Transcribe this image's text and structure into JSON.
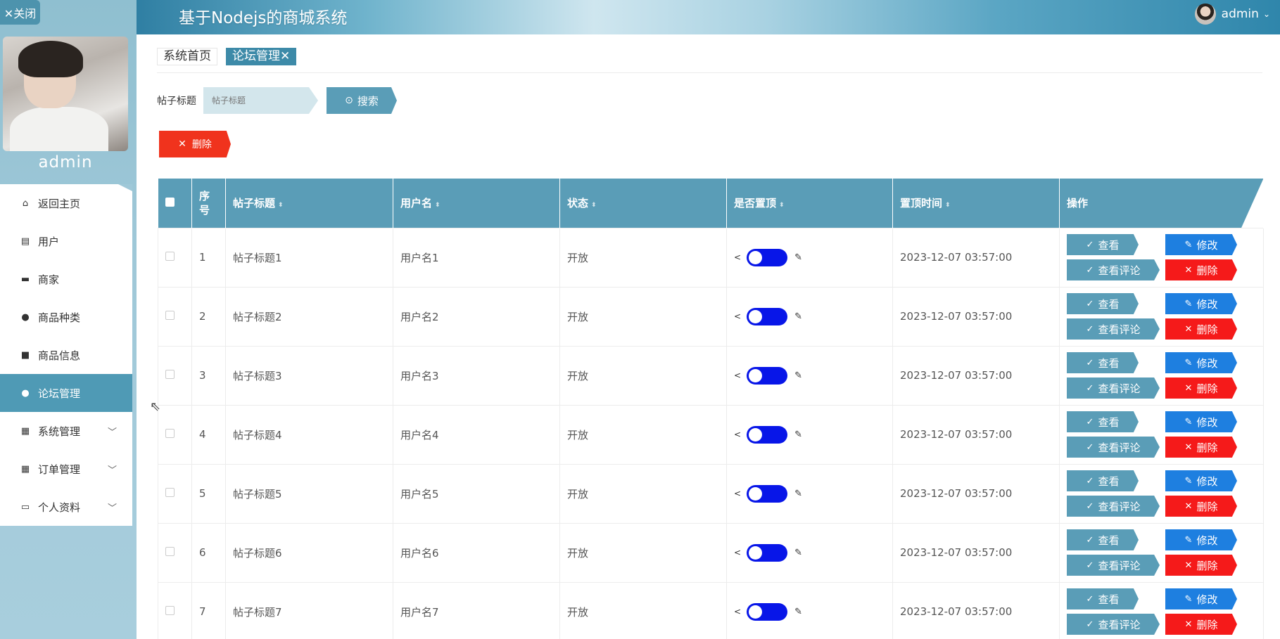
{
  "sidebar": {
    "close_label": "✕关闭",
    "username": "admin",
    "items": [
      {
        "label": "返回主页",
        "icon": "home-icon"
      },
      {
        "label": "用户",
        "icon": "clipboard-icon"
      },
      {
        "label": "商家",
        "icon": "briefcase-icon"
      },
      {
        "label": "商品种类",
        "icon": "person-icon"
      },
      {
        "label": "商品信息",
        "icon": "box-icon"
      },
      {
        "label": "论坛管理",
        "icon": "bulb-icon",
        "active": true
      },
      {
        "label": "系统管理",
        "icon": "grid-icon",
        "expandable": true
      },
      {
        "label": "订单管理",
        "icon": "grid-icon",
        "expandable": true
      },
      {
        "label": "个人资料",
        "icon": "card-icon",
        "expandable": true
      }
    ]
  },
  "header": {
    "title": "基于Nodejs的商城系统",
    "user": "admin"
  },
  "tabs": [
    {
      "label": "系统首页"
    },
    {
      "label": "论坛管理✕",
      "active": true
    }
  ],
  "search": {
    "label": "帖子标题",
    "placeholder": "帖子标题",
    "button": "搜索"
  },
  "batch_delete": "删除",
  "table": {
    "headers": {
      "index": "序号",
      "title": "帖子标题",
      "user": "用户名",
      "status": "状态",
      "pinned": "是否置顶",
      "pin_time": "置顶时间",
      "ops": "操作"
    },
    "rows": [
      {
        "index": "1",
        "title": "帖子标题1",
        "user": "用户名1",
        "status": "开放",
        "pin_time": "2023-12-07 03:57:00"
      },
      {
        "index": "2",
        "title": "帖子标题2",
        "user": "用户名2",
        "status": "开放",
        "pin_time": "2023-12-07 03:57:00"
      },
      {
        "index": "3",
        "title": "帖子标题3",
        "user": "用户名3",
        "status": "开放",
        "pin_time": "2023-12-07 03:57:00"
      },
      {
        "index": "4",
        "title": "帖子标题4",
        "user": "用户名4",
        "status": "开放",
        "pin_time": "2023-12-07 03:57:00"
      },
      {
        "index": "5",
        "title": "帖子标题5",
        "user": "用户名5",
        "status": "开放",
        "pin_time": "2023-12-07 03:57:00"
      },
      {
        "index": "6",
        "title": "帖子标题6",
        "user": "用户名6",
        "status": "开放",
        "pin_time": "2023-12-07 03:57:00"
      },
      {
        "index": "7",
        "title": "帖子标题7",
        "user": "用户名7",
        "status": "开放",
        "pin_time": "2023-12-07 03:57:00"
      }
    ],
    "op_labels": {
      "view": "查看",
      "edit": "修改",
      "comments": "查看评论",
      "delete": "删除"
    }
  },
  "colors": {
    "accent": "#5a9db7",
    "sidebar_active": "#4f9ab5",
    "edit_blue": "#1e7fe0",
    "delete_red": "#f51a1a",
    "switch_on": "#0816e8"
  }
}
